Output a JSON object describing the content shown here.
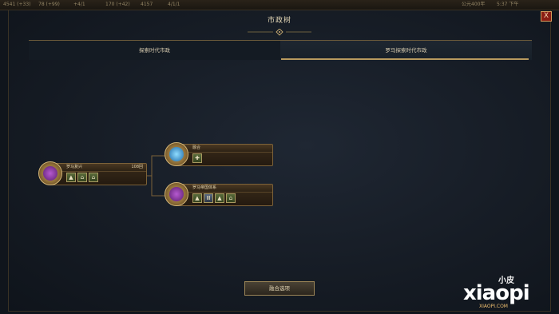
{
  "top_bar": {
    "resources": [
      "4541 (+33)",
      "78 (+99)",
      "+4/1",
      "170 (+42)",
      "4157",
      "4/1/1"
    ],
    "right_info": [
      "公元400年",
      "5:37 下午"
    ]
  },
  "window": {
    "title": "市政树",
    "close_label": "X"
  },
  "tabs": [
    {
      "label": "探索时代市政",
      "active": false
    },
    {
      "label": "罗马探索时代市政",
      "active": true
    }
  ],
  "nodes": {
    "root": {
      "name": "罗马复兴",
      "cost": "108回",
      "icons": [
        "triangle-icon",
        "house-icon",
        "house-icon"
      ],
      "medal_color": "#7a2e8c"
    },
    "top": {
      "name": "融合",
      "cost": "",
      "icons": [
        "plus-icon"
      ],
      "medal_color": "#2d8fd0"
    },
    "bottom": {
      "name": "罗马帝国体系",
      "cost": "",
      "icons": [
        "triangle-icon",
        "column-icon",
        "triangle-icon",
        "house-icon"
      ],
      "medal_color": "#7a2e8c"
    }
  },
  "footer": {
    "merge_button": "融合选项"
  },
  "watermark": {
    "small": "小皮",
    "big": "xiaopi",
    "url": "XIAOPI.COM"
  },
  "colors": {
    "accent_gold": "#b89a5e",
    "close_red": "#8a1d14"
  }
}
